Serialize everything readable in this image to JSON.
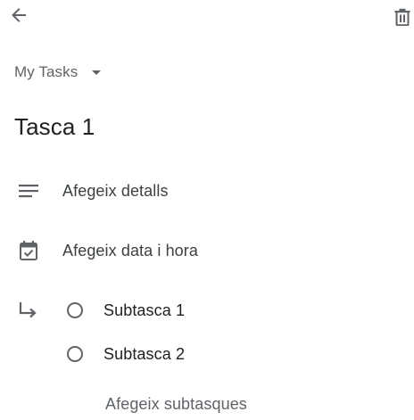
{
  "toolbar": {
    "back_icon": "arrow-back-icon",
    "delete_icon": "trash-icon"
  },
  "list_selector": {
    "label": "My Tasks",
    "icon": "caret-down-icon"
  },
  "task": {
    "title": "Tasca 1"
  },
  "details": {
    "label": "Afegeix detalls",
    "icon": "notes-icon"
  },
  "date": {
    "label": "Afegeix data i hora",
    "icon": "calendar-icon"
  },
  "subtasks": {
    "icon": "subdirectory-arrow-icon",
    "items": [
      {
        "label": "Subtasca 1"
      },
      {
        "label": "Subtasca 2"
      }
    ],
    "add_label": "Afegeix subtasques"
  }
}
